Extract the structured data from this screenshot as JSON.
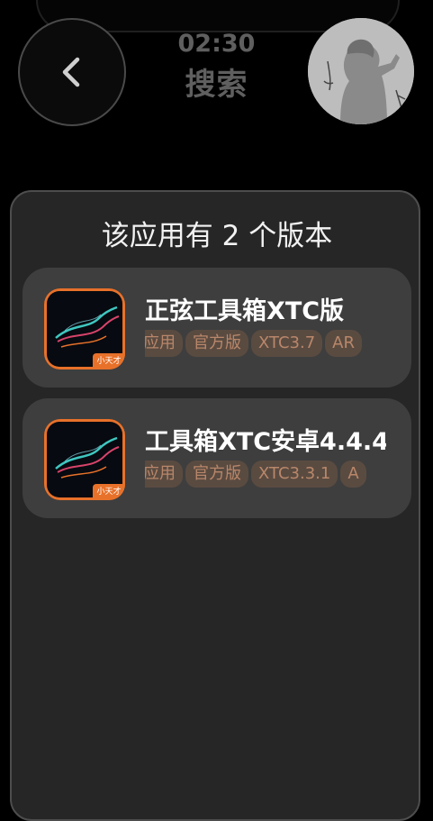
{
  "header": {
    "time": "02:30",
    "title": "搜索"
  },
  "panel": {
    "title": "该应用有 2 个版本"
  },
  "versions": [
    {
      "name": "正弦工具箱XTC版",
      "tags": [
        "应用",
        "官方版",
        "XTC3.7",
        "AR"
      ],
      "icon_badge": "小天才"
    },
    {
      "name": "工具箱XTC安卓4.4.4",
      "tags": [
        "应用",
        "官方版",
        "XTC3.3.1",
        "A"
      ],
      "icon_badge": "小天才"
    }
  ],
  "colors": {
    "background": "#000000",
    "panel": "#262626",
    "card": "#3e3e3e",
    "tag_bg": "#5a4b41",
    "tag_text": "#b8876a",
    "icon_accent": "#e8712a"
  }
}
